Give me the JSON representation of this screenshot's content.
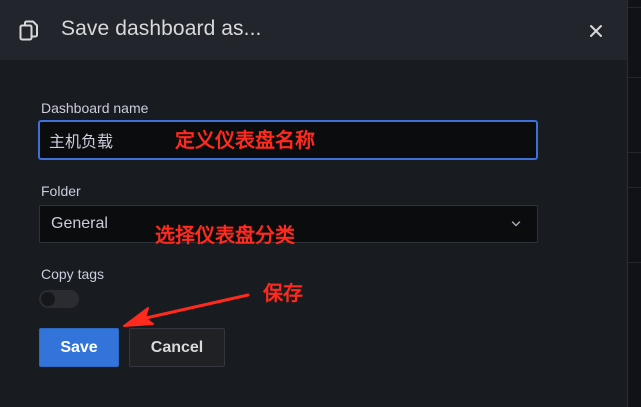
{
  "dialog": {
    "title": "Save dashboard as...",
    "header_icon": "copy-icon",
    "close_icon": "close-icon"
  },
  "form": {
    "dashboard_name": {
      "label": "Dashboard name",
      "value": "主机负载"
    },
    "folder": {
      "label": "Folder",
      "selected": "General",
      "icon": "chevron-down-icon"
    },
    "copy_tags": {
      "label": "Copy tags",
      "enabled": false
    }
  },
  "buttons": {
    "save_label": "Save",
    "cancel_label": "Cancel"
  },
  "annotations": {
    "name_note": "定义仪表盘名称",
    "folder_note": "选择仪表盘分类",
    "save_note": "保存"
  },
  "colors": {
    "primary": "#3274d9",
    "annotation": "#ff2a1e",
    "modal_bg": "#181b1f",
    "header_bg": "#22252b"
  }
}
